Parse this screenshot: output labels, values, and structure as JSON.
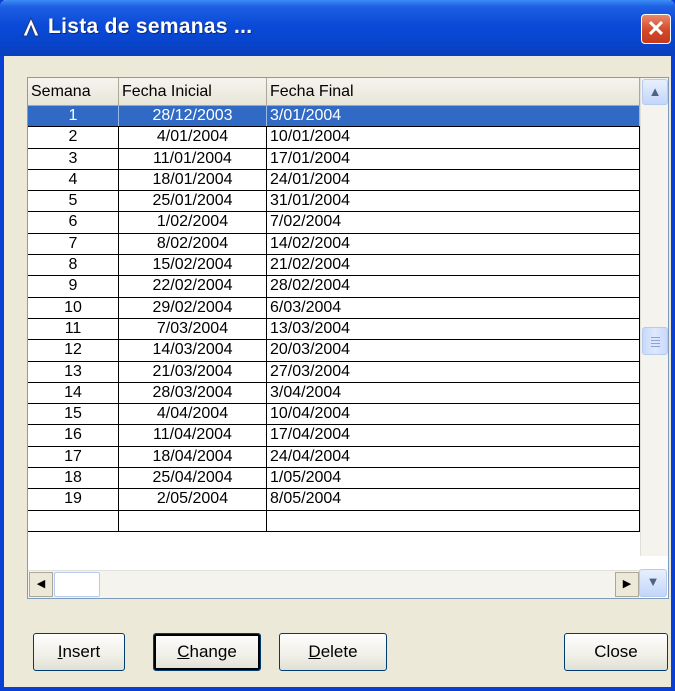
{
  "window": {
    "title": "Lista de semanas ...",
    "close_glyph": "✕"
  },
  "table": {
    "columns": [
      "Semana",
      "Fecha Inicial",
      "Fecha Final"
    ],
    "rows": [
      [
        "1",
        "28/12/2003",
        "3/01/2004"
      ],
      [
        "2",
        "4/01/2004",
        "10/01/2004"
      ],
      [
        "3",
        "11/01/2004",
        "17/01/2004"
      ],
      [
        "4",
        "18/01/2004",
        "24/01/2004"
      ],
      [
        "5",
        "25/01/2004",
        "31/01/2004"
      ],
      [
        "6",
        "1/02/2004",
        "7/02/2004"
      ],
      [
        "7",
        "8/02/2004",
        "14/02/2004"
      ],
      [
        "8",
        "15/02/2004",
        "21/02/2004"
      ],
      [
        "9",
        "22/02/2004",
        "28/02/2004"
      ],
      [
        "10",
        "29/02/2004",
        "6/03/2004"
      ],
      [
        "11",
        "7/03/2004",
        "13/03/2004"
      ],
      [
        "12",
        "14/03/2004",
        "20/03/2004"
      ],
      [
        "13",
        "21/03/2004",
        "27/03/2004"
      ],
      [
        "14",
        "28/03/2004",
        "3/04/2004"
      ],
      [
        "15",
        "4/04/2004",
        "10/04/2004"
      ],
      [
        "16",
        "11/04/2004",
        "17/04/2004"
      ],
      [
        "17",
        "18/04/2004",
        "24/04/2004"
      ],
      [
        "18",
        "25/04/2004",
        "1/05/2004"
      ],
      [
        "19",
        "2/05/2004",
        "8/05/2004"
      ]
    ],
    "selected_row": 0
  },
  "scrollbar_glyphs": {
    "up": "▲",
    "down": "▼",
    "left": "◀",
    "right": "▶"
  },
  "buttons": {
    "insert": {
      "accel": "I",
      "rest": "nsert"
    },
    "change": {
      "accel": "C",
      "rest": "hange"
    },
    "delete": {
      "accel": "D",
      "rest": "elete"
    },
    "close": {
      "label": "Close"
    }
  },
  "colors": {
    "selection": "#316ac5",
    "titlebar": "#0a4ad8",
    "close": "#d4482a"
  }
}
